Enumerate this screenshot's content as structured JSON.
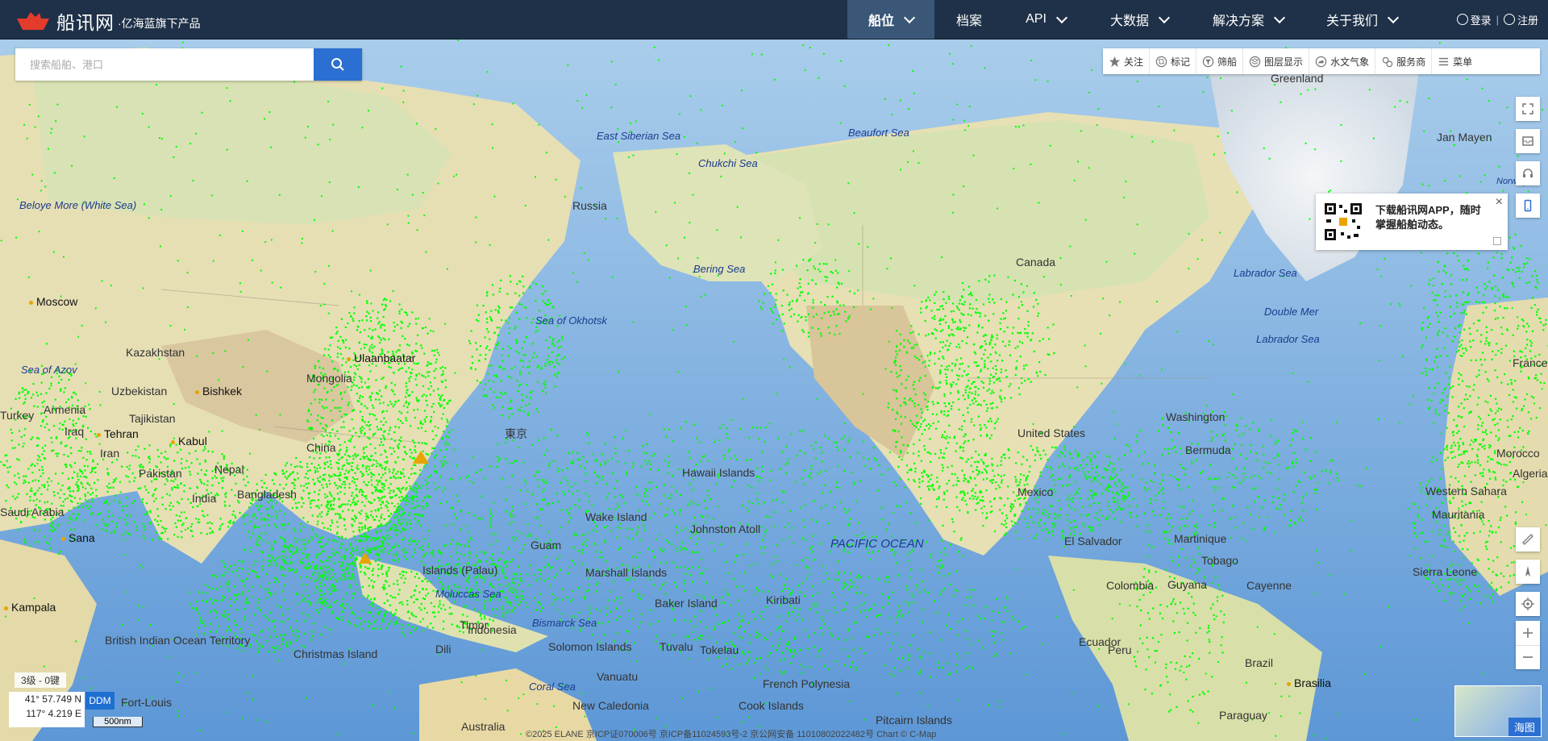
{
  "header": {
    "brand": "船讯网",
    "brand_sub": "·亿海蓝旗下产品",
    "nav": [
      {
        "label": "船位",
        "active": true,
        "dropdown": true
      },
      {
        "label": "档案",
        "active": false,
        "dropdown": false
      },
      {
        "label": "API",
        "active": false,
        "dropdown": true
      },
      {
        "label": "大数据",
        "active": false,
        "dropdown": true
      },
      {
        "label": "解决方案",
        "active": false,
        "dropdown": true
      },
      {
        "label": "关于我们",
        "active": false,
        "dropdown": true
      }
    ],
    "login": "登录",
    "register": "注册"
  },
  "search": {
    "placeholder": "搜索船舶、港口"
  },
  "toolbar": {
    "items": [
      {
        "label": "关注",
        "icon": "star-icon"
      },
      {
        "label": "标记",
        "icon": "tag-icon"
      },
      {
        "label": "筛船",
        "icon": "filter-icon"
      },
      {
        "label": "图层显示",
        "icon": "layers-icon"
      },
      {
        "label": "水文气象",
        "icon": "weather-icon"
      },
      {
        "label": "服务商",
        "icon": "service-icon"
      },
      {
        "label": "菜单",
        "icon": "menu-icon"
      }
    ]
  },
  "promo": {
    "line1": "下载船讯网APP，随时",
    "line2": "掌握船舶动态。"
  },
  "map": {
    "labels": [
      {
        "text": "East Siberian Sea",
        "kind": "sea"
      },
      {
        "text": "Beaufort Sea",
        "kind": "sea"
      },
      {
        "text": "Chukchi Sea",
        "kind": "sea"
      },
      {
        "text": "Greenland",
        "kind": "land"
      },
      {
        "text": "Jan Mayen",
        "kind": "land"
      },
      {
        "text": "Norwegian",
        "kind": "sea"
      },
      {
        "text": "Beloye More (White Sea)",
        "kind": "sea"
      },
      {
        "text": "Russia",
        "kind": "land"
      },
      {
        "text": "Bering Sea",
        "kind": "sea"
      },
      {
        "text": "Canada",
        "kind": "land"
      },
      {
        "text": "Labrador Sea",
        "kind": "sea"
      },
      {
        "text": "Moscow",
        "kind": "city"
      },
      {
        "text": "Sea of Okhotsk",
        "kind": "sea"
      },
      {
        "text": "Double Mer",
        "kind": "sea"
      },
      {
        "text": "Labrador Sea",
        "kind": "sea"
      },
      {
        "text": "Kazakhstan",
        "kind": "land"
      },
      {
        "text": "Ulaanbaatar",
        "kind": "city"
      },
      {
        "text": "Mongolia",
        "kind": "land"
      },
      {
        "text": "Sea of Azov",
        "kind": "sea"
      },
      {
        "text": "Uzbekistan",
        "kind": "land"
      },
      {
        "text": "Bishkek",
        "kind": "city"
      },
      {
        "text": "Tajikistan",
        "kind": "land"
      },
      {
        "text": "Turkey",
        "kind": "land"
      },
      {
        "text": "Armenia",
        "kind": "land"
      },
      {
        "text": "Iraq",
        "kind": "land"
      },
      {
        "text": "Iran",
        "kind": "land"
      },
      {
        "text": "Tehran",
        "kind": "city"
      },
      {
        "text": "Kabul",
        "kind": "city"
      },
      {
        "text": "China",
        "kind": "land"
      },
      {
        "text": "東京",
        "kind": "land"
      },
      {
        "text": "Pakistan",
        "kind": "land"
      },
      {
        "text": "Nepal",
        "kind": "land"
      },
      {
        "text": "Bangladesh",
        "kind": "land"
      },
      {
        "text": "India",
        "kind": "land"
      },
      {
        "text": "Saudi Arabia",
        "kind": "land"
      },
      {
        "text": "Sana",
        "kind": "city"
      },
      {
        "text": "Kampala",
        "kind": "city"
      },
      {
        "text": "Washington",
        "kind": "city"
      },
      {
        "text": "United States",
        "kind": "land"
      },
      {
        "text": "Bermuda",
        "kind": "land"
      },
      {
        "text": "Mexico",
        "kind": "land"
      },
      {
        "text": "El Salvador",
        "kind": "land"
      },
      {
        "text": "Colombia",
        "kind": "land"
      },
      {
        "text": "Guyana",
        "kind": "land"
      },
      {
        "text": "Cayenne",
        "kind": "land"
      },
      {
        "text": "Ecuador",
        "kind": "land"
      },
      {
        "text": "Peru",
        "kind": "land"
      },
      {
        "text": "Brazil",
        "kind": "land"
      },
      {
        "text": "Brasilia",
        "kind": "city"
      },
      {
        "text": "Paraguay",
        "kind": "land"
      },
      {
        "text": "Western Sahara",
        "kind": "land"
      },
      {
        "text": "Mauritania",
        "kind": "land"
      },
      {
        "text": "Sierra Leone",
        "kind": "land"
      },
      {
        "text": "Morocco",
        "kind": "land"
      },
      {
        "text": "Algeria",
        "kind": "land"
      },
      {
        "text": "France",
        "kind": "land"
      },
      {
        "text": "Martinique",
        "kind": "land"
      },
      {
        "text": "Tobago",
        "kind": "land"
      },
      {
        "text": "Wake Island",
        "kind": "land"
      },
      {
        "text": "Johnston Atoll",
        "kind": "land"
      },
      {
        "text": "Marshall Islands",
        "kind": "land"
      },
      {
        "text": "Guam",
        "kind": "land"
      },
      {
        "text": "Islands (Palau)",
        "kind": "land"
      },
      {
        "text": "Moluccas Sea",
        "kind": "sea"
      },
      {
        "text": "Bismarck Sea",
        "kind": "sea"
      },
      {
        "text": "Solomon Islands",
        "kind": "land"
      },
      {
        "text": "Tuvalu",
        "kind": "land"
      },
      {
        "text": "Tokelau",
        "kind": "land"
      },
      {
        "text": "Vanuatu",
        "kind": "land"
      },
      {
        "text": "Coral Sea",
        "kind": "sea"
      },
      {
        "text": "New Caledonia",
        "kind": "land"
      },
      {
        "text": "Cook Islands",
        "kind": "land"
      },
      {
        "text": "French Polynesia",
        "kind": "land"
      },
      {
        "text": "Pitcairn Islands",
        "kind": "land"
      },
      {
        "text": "Australia",
        "kind": "land"
      },
      {
        "text": "Christmas Island",
        "kind": "land"
      },
      {
        "text": "British Indian Ocean Territory",
        "kind": "land"
      },
      {
        "text": "Baker Island",
        "kind": "land"
      },
      {
        "text": "Kiribati",
        "kind": "land"
      },
      {
        "text": "Timor",
        "kind": "land"
      },
      {
        "text": "Fort-Louis",
        "kind": "land"
      },
      {
        "text": "Dili",
        "kind": "land"
      },
      {
        "text": "Indonesia",
        "kind": "land"
      },
      {
        "text": "PACIFIC OCEAN",
        "kind": "ocean"
      },
      {
        "text": "Hawaii Islands",
        "kind": "land"
      }
    ]
  },
  "status": {
    "zoom": "3级 - 0键",
    "lat": "41° 57.749 N",
    "lon": "117° 4.219 E",
    "format": "DDM",
    "scale": "500nm",
    "copyright": "©2025 ELANE  京ICP证070006号  京ICP备11024593号-2   京公网安备 11010802022482号   Chart © C-Map"
  },
  "minimap": {
    "label": "海图"
  },
  "colors": {
    "navbar": "#1f3148",
    "nav_active": "#3a5778",
    "accent": "#2a6fd1",
    "ship": "#00ff00",
    "ocean": "#7fb2df",
    "land": "#e7dfb2"
  }
}
